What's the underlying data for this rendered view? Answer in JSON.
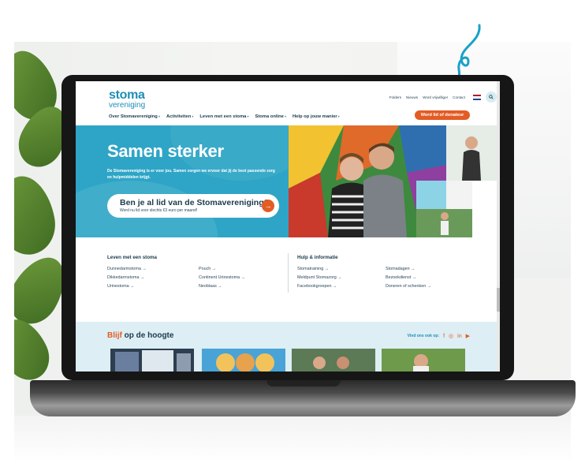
{
  "site": {
    "logo_main": "stoma",
    "logo_sub": "vereniging",
    "utility_nav": [
      "Folders",
      "Nieuws",
      "Word vrijwilliger",
      "Contact"
    ],
    "main_nav": [
      "Over Stomavereniging",
      "Activiteiten",
      "Leven met een stoma",
      "Stoma online",
      "Help op jouw manier"
    ],
    "cta_label": "Word lid of donateur"
  },
  "hero": {
    "title": "Samen sterker",
    "text": "De Stomavereniging is er voor jou. Samen zorgen we ervoor dat jij de best passende zorg en hulpmiddelen krijgt.",
    "card_title": "Ben je al lid van de Stomavereniging?",
    "card_sub": "Word nu lid voor slechts €3 euro per maand!"
  },
  "links": {
    "left_heading": "Leven met een stoma",
    "left_col1": [
      "Dunnedarmstoma →",
      "Dikkedarmstoma →",
      "Urinestoma →"
    ],
    "left_col2": [
      "Pouch →",
      "Continent Urinestoma →",
      "Neoblaas →"
    ],
    "right_heading": "Hulp & informatie",
    "right_col1": [
      "Stomatraining →",
      "Meldpunt Stomazorg →",
      "Facebookgroepen →"
    ],
    "right_col2": [
      "Stomadagen →",
      "Bezoekdienst →",
      "Doneren of schenken →"
    ]
  },
  "stay": {
    "title_accent": "Blijf",
    "title_rest": " op de hoogte",
    "find_us": "Vind ons ook op:",
    "social_icons": [
      "facebook-icon",
      "instagram-icon",
      "linkedin-icon",
      "youtube-icon"
    ]
  },
  "colors": {
    "brand_blue": "#1e8fb5",
    "hero_blue": "#2ea5c6",
    "orange": "#e35c24"
  }
}
